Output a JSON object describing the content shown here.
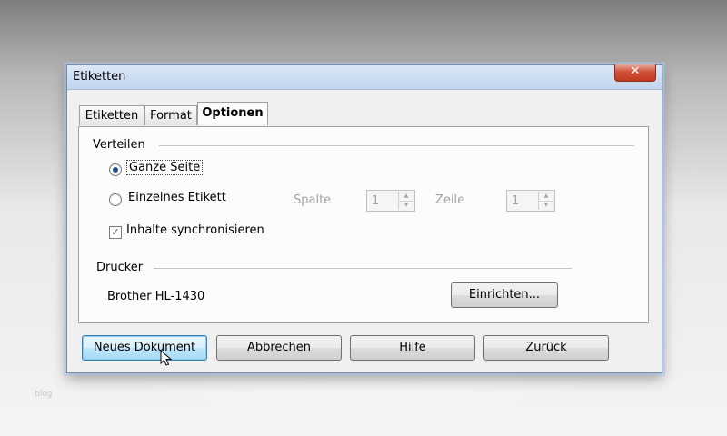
{
  "dialog": {
    "title": "Etiketten",
    "close_symbol": "✕"
  },
  "tabs": [
    {
      "label": "Etiketten",
      "active": false
    },
    {
      "label": "Format",
      "active": false
    },
    {
      "label": "Optionen",
      "active": true
    }
  ],
  "verteilen": {
    "heading": "Verteilen",
    "option_full_page": {
      "label": "Ganze Seite",
      "checked": true
    },
    "option_single_label": {
      "label": "Einzelnes Etikett",
      "checked": false
    },
    "spalte": {
      "label": "Spalte",
      "value": "1",
      "enabled": false
    },
    "zeile": {
      "label": "Zeile",
      "value": "1",
      "enabled": false
    },
    "sync": {
      "label": "Inhalte synchronisieren",
      "checked": true
    }
  },
  "drucker": {
    "heading": "Drucker",
    "printer_name": "Brother HL-1430",
    "setup_button": "Einrichten..."
  },
  "footer": {
    "new_document": "Neues Dokument",
    "cancel": "Abbrechen",
    "help": "Hilfe",
    "back": "Zurück"
  },
  "watermark": "blog",
  "colors": {
    "title_bar": "#c3d6ee",
    "close_button": "#c23a1f",
    "default_button": "#bee6fd"
  }
}
